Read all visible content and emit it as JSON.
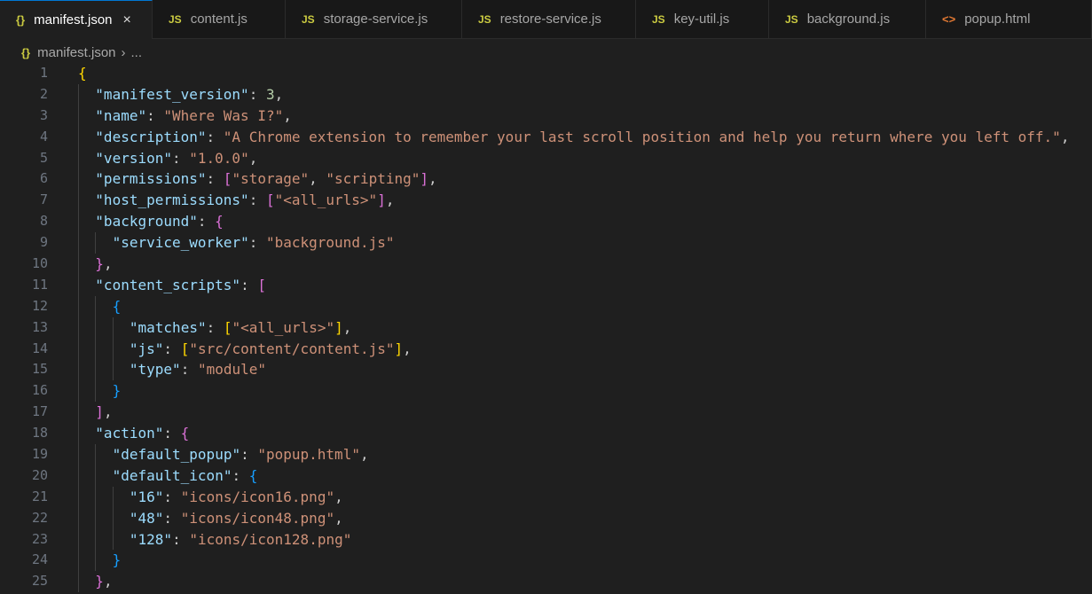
{
  "tabs": [
    {
      "icon": "{}",
      "label": "manifest.json",
      "active": true,
      "close": "×"
    },
    {
      "icon": "JS",
      "label": "content.js"
    },
    {
      "icon": "JS",
      "label": "storage-service.js"
    },
    {
      "icon": "JS",
      "label": "restore-service.js"
    },
    {
      "icon": "JS",
      "label": "key-util.js"
    },
    {
      "icon": "JS",
      "label": "background.js"
    },
    {
      "icon": "<>",
      "label": "popup.html"
    }
  ],
  "breadcrumb": {
    "icon": "{}",
    "file": "manifest.json",
    "separator": "›",
    "more": "..."
  },
  "colors": {
    "key": "#9cdcfe",
    "string": "#ce9178",
    "number": "#b5cea8",
    "bracket1": "#ffd700",
    "bracket2": "#da70d6",
    "bracket3": "#179fff",
    "accent": "#0078d4"
  },
  "lines": [
    {
      "n": "1",
      "indent": 0,
      "tokens": [
        [
          "{",
          "b1"
        ]
      ]
    },
    {
      "n": "2",
      "indent": 1,
      "tokens": [
        [
          "\"manifest_version\"",
          "k"
        ],
        [
          ": ",
          "p"
        ],
        [
          "3",
          "n"
        ],
        [
          ",",
          "p"
        ]
      ]
    },
    {
      "n": "3",
      "indent": 1,
      "tokens": [
        [
          "\"name\"",
          "k"
        ],
        [
          ": ",
          "p"
        ],
        [
          "\"Where Was I?\"",
          "s"
        ],
        [
          ",",
          "p"
        ]
      ]
    },
    {
      "n": "4",
      "indent": 1,
      "tokens": [
        [
          "\"description\"",
          "k"
        ],
        [
          ": ",
          "p"
        ],
        [
          "\"A Chrome extension to remember your last scroll position and help you return where you left off.\"",
          "s"
        ],
        [
          ",",
          "p"
        ]
      ]
    },
    {
      "n": "5",
      "indent": 1,
      "tokens": [
        [
          "\"version\"",
          "k"
        ],
        [
          ": ",
          "p"
        ],
        [
          "\"1.0.0\"",
          "s"
        ],
        [
          ",",
          "p"
        ]
      ]
    },
    {
      "n": "6",
      "indent": 1,
      "tokens": [
        [
          "\"permissions\"",
          "k"
        ],
        [
          ": ",
          "p"
        ],
        [
          "[",
          "b2"
        ],
        [
          "\"storage\"",
          "s"
        ],
        [
          ", ",
          "p"
        ],
        [
          "\"scripting\"",
          "s"
        ],
        [
          "]",
          "b2"
        ],
        [
          ",",
          "p"
        ]
      ]
    },
    {
      "n": "7",
      "indent": 1,
      "tokens": [
        [
          "\"host_permissions\"",
          "k"
        ],
        [
          ": ",
          "p"
        ],
        [
          "[",
          "b2"
        ],
        [
          "\"<all_urls>\"",
          "s"
        ],
        [
          "]",
          "b2"
        ],
        [
          ",",
          "p"
        ]
      ]
    },
    {
      "n": "8",
      "indent": 1,
      "tokens": [
        [
          "\"background\"",
          "k"
        ],
        [
          ": ",
          "p"
        ],
        [
          "{",
          "b2"
        ]
      ]
    },
    {
      "n": "9",
      "indent": 2,
      "tokens": [
        [
          "\"service_worker\"",
          "k"
        ],
        [
          ": ",
          "p"
        ],
        [
          "\"background.js\"",
          "s"
        ]
      ]
    },
    {
      "n": "10",
      "indent": 1,
      "tokens": [
        [
          "}",
          "b2"
        ],
        [
          ",",
          "p"
        ]
      ]
    },
    {
      "n": "11",
      "indent": 1,
      "tokens": [
        [
          "\"content_scripts\"",
          "k"
        ],
        [
          ": ",
          "p"
        ],
        [
          "[",
          "b2"
        ]
      ]
    },
    {
      "n": "12",
      "indent": 2,
      "tokens": [
        [
          "{",
          "b3"
        ]
      ]
    },
    {
      "n": "13",
      "indent": 3,
      "tokens": [
        [
          "\"matches\"",
          "k"
        ],
        [
          ": ",
          "p"
        ],
        [
          "[",
          "b1"
        ],
        [
          "\"<all_urls>\"",
          "s"
        ],
        [
          "]",
          "b1"
        ],
        [
          ",",
          "p"
        ]
      ]
    },
    {
      "n": "14",
      "indent": 3,
      "tokens": [
        [
          "\"js\"",
          "k"
        ],
        [
          ": ",
          "p"
        ],
        [
          "[",
          "b1"
        ],
        [
          "\"src/content/content.js\"",
          "s"
        ],
        [
          "]",
          "b1"
        ],
        [
          ",",
          "p"
        ]
      ]
    },
    {
      "n": "15",
      "indent": 3,
      "tokens": [
        [
          "\"type\"",
          "k"
        ],
        [
          ": ",
          "p"
        ],
        [
          "\"module\"",
          "s"
        ]
      ]
    },
    {
      "n": "16",
      "indent": 2,
      "tokens": [
        [
          "}",
          "b3"
        ]
      ]
    },
    {
      "n": "17",
      "indent": 1,
      "tokens": [
        [
          "]",
          "b2"
        ],
        [
          ",",
          "p"
        ]
      ]
    },
    {
      "n": "18",
      "indent": 1,
      "tokens": [
        [
          "\"action\"",
          "k"
        ],
        [
          ": ",
          "p"
        ],
        [
          "{",
          "b2"
        ]
      ]
    },
    {
      "n": "19",
      "indent": 2,
      "tokens": [
        [
          "\"default_popup\"",
          "k"
        ],
        [
          ": ",
          "p"
        ],
        [
          "\"popup.html\"",
          "s"
        ],
        [
          ",",
          "p"
        ]
      ]
    },
    {
      "n": "20",
      "indent": 2,
      "tokens": [
        [
          "\"default_icon\"",
          "k"
        ],
        [
          ": ",
          "p"
        ],
        [
          "{",
          "b3"
        ]
      ]
    },
    {
      "n": "21",
      "indent": 3,
      "tokens": [
        [
          "\"16\"",
          "k"
        ],
        [
          ": ",
          "p"
        ],
        [
          "\"icons/icon16.png\"",
          "s"
        ],
        [
          ",",
          "p"
        ]
      ]
    },
    {
      "n": "22",
      "indent": 3,
      "tokens": [
        [
          "\"48\"",
          "k"
        ],
        [
          ": ",
          "p"
        ],
        [
          "\"icons/icon48.png\"",
          "s"
        ],
        [
          ",",
          "p"
        ]
      ]
    },
    {
      "n": "23",
      "indent": 3,
      "tokens": [
        [
          "\"128\"",
          "k"
        ],
        [
          ": ",
          "p"
        ],
        [
          "\"icons/icon128.png\"",
          "s"
        ]
      ]
    },
    {
      "n": "24",
      "indent": 2,
      "tokens": [
        [
          "}",
          "b3"
        ]
      ]
    },
    {
      "n": "25",
      "indent": 1,
      "tokens": [
        [
          "}",
          "b2"
        ],
        [
          ",",
          "p"
        ]
      ]
    }
  ]
}
